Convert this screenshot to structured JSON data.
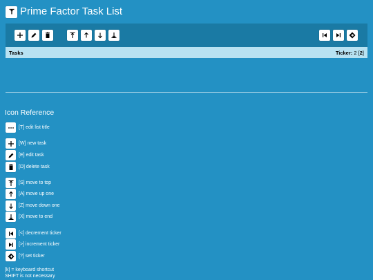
{
  "app": {
    "title": "Prime Factor Task List",
    "title_icon": "T-bar-icon"
  },
  "toolbar": {
    "buttons": [
      "plus-icon",
      "pencil-icon",
      "trash-icon",
      "move-top-icon",
      "arrow-up-icon",
      "arrow-down-icon",
      "move-end-icon",
      "skip-back-icon",
      "skip-forward-icon",
      "diamond-icon"
    ]
  },
  "tasks_header": {
    "label": "Tasks",
    "ticker_label": "Ticker:",
    "ticker_value": "2",
    "ticker_bracket_open": "[",
    "ticker_current": "2",
    "ticker_bracket_close": "]"
  },
  "reference": {
    "heading": "Icon Reference",
    "items": [
      {
        "icon": "ellipsis-icon",
        "text": "[T] edit list title"
      },
      {
        "icon": "plus-icon",
        "text": "[W] new task"
      },
      {
        "icon": "pencil-icon",
        "text": "[E] edit task"
      },
      {
        "icon": "trash-icon",
        "text": "[D] delete task"
      },
      {
        "icon": "move-top-icon",
        "text": "[S] move to top"
      },
      {
        "icon": "arrow-up-icon",
        "text": "[A] move up one"
      },
      {
        "icon": "arrow-down-icon",
        "text": "[Z] move down one"
      },
      {
        "icon": "move-end-icon",
        "text": "[X] move to end"
      },
      {
        "icon": "skip-back-icon",
        "text": "[<] decrement ticker"
      },
      {
        "icon": "skip-forward-icon",
        "text": "[>] increment ticker"
      },
      {
        "icon": "diamond-icon",
        "text": "[?] set ticker"
      }
    ],
    "note1": "[k] = keyboard shortcut",
    "note2": "SHIFT is not necessary"
  },
  "colors": {
    "background": "#2391c4",
    "toolbar": "#1a7aa4",
    "header": "#b8e2f2"
  }
}
